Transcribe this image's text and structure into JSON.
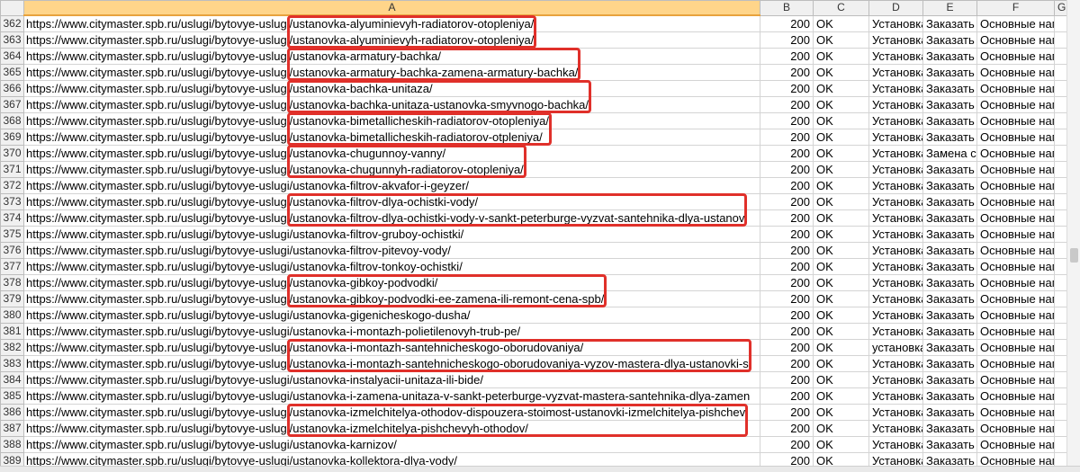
{
  "columns": [
    "A",
    "B",
    "C",
    "D",
    "E",
    "F",
    "G"
  ],
  "selected_column": "A",
  "url_prefix": "https://www.citymaster.spb.ru/uslugi/bytovye-uslugi",
  "rows": [
    {
      "n": "362",
      "slug": "/ustanovka-alyuminievyh-radiatorov-otopleniya/",
      "code": "200",
      "status": "OK",
      "d": "Установка",
      "e": "Заказать у",
      "f": "Основные напра"
    },
    {
      "n": "363",
      "slug": "/ustanovka-alyuminievyh-radiatorov-otopleniya/",
      "code": "200",
      "status": "OK",
      "d": "Установка",
      "e": "Заказать у",
      "f": "Основные напра"
    },
    {
      "n": "364",
      "slug": "/ustanovka-armatury-bachka/",
      "code": "200",
      "status": "OK",
      "d": "Установка",
      "e": "Заказать у",
      "f": "Основные напра"
    },
    {
      "n": "365",
      "slug": "/ustanovka-armatury-bachka-zamena-armatury-bachka/",
      "code": "200",
      "status": "OK",
      "d": "Установка",
      "e": "Заказать у",
      "f": "Основные напра"
    },
    {
      "n": "366",
      "slug": "/ustanovka-bachka-unitaza/",
      "code": "200",
      "status": "OK",
      "d": "Установка",
      "e": "Заказать у",
      "f": "Основные напра"
    },
    {
      "n": "367",
      "slug": "/ustanovka-bachka-unitaza-ustanovka-smyvnogo-bachka/",
      "code": "200",
      "status": "OK",
      "d": "Установка",
      "e": "Заказать у",
      "f": "Основные напра"
    },
    {
      "n": "368",
      "slug": "/ustanovka-bimetallicheskih-radiatorov-otopleniya/",
      "code": "200",
      "status": "OK",
      "d": "Установка",
      "e": "Заказать у",
      "f": "Основные напра"
    },
    {
      "n": "369",
      "slug": "/ustanovka-bimetallicheskih-radiatorov-otpleniya/",
      "code": "200",
      "status": "OK",
      "d": "Установка",
      "e": "Заказать у",
      "f": "Основные напра"
    },
    {
      "n": "370",
      "slug": "/ustanovka-chugunnoy-vanny/",
      "code": "200",
      "status": "OK",
      "d": "Установка",
      "e": "Замена ст",
      "f": "Основные напра"
    },
    {
      "n": "371",
      "slug": "/ustanovka-chugunnyh-radiatorov-otopleniya/",
      "code": "200",
      "status": "OK",
      "d": "Установка",
      "e": "Заказать у",
      "f": "Основные напра"
    },
    {
      "n": "372",
      "slug": "/ustanovka-filtrov-akvafor-i-geyzer/",
      "code": "200",
      "status": "OK",
      "d": "Установка",
      "e": "Заказать у",
      "f": "Основные напра"
    },
    {
      "n": "373",
      "slug": "/ustanovka-filtrov-dlya-ochistki-vody/",
      "code": "200",
      "status": "OK",
      "d": "Установка",
      "e": "Заказать у",
      "f": "Основные напра"
    },
    {
      "n": "374",
      "slug": "/ustanovka-filtrov-dlya-ochistki-vody-v-sankt-peterburge-vyzvat-santehnika-dlya-ustanov",
      "code": "200",
      "status": "OK",
      "d": "Установка",
      "e": "Заказать у",
      "f": "Основные напра"
    },
    {
      "n": "375",
      "slug": "/ustanovka-filtrov-gruboy-ochistki/",
      "code": "200",
      "status": "OK",
      "d": "Установка",
      "e": "Заказать у",
      "f": "Основные напра"
    },
    {
      "n": "376",
      "slug": "/ustanovka-filtrov-pitevoy-vody/",
      "code": "200",
      "status": "OK",
      "d": "Установка",
      "e": "Заказать у",
      "f": "Основные напра"
    },
    {
      "n": "377",
      "slug": "/ustanovka-filtrov-tonkoy-ochistki/",
      "code": "200",
      "status": "OK",
      "d": "Установка",
      "e": "Заказать у",
      "f": "Основные напра"
    },
    {
      "n": "378",
      "slug": "/ustanovka-gibkoy-podvodki/",
      "code": "200",
      "status": "OK",
      "d": "Установка",
      "e": "Заказать у",
      "f": "Основные напра"
    },
    {
      "n": "379",
      "slug": "/ustanovka-gibkoy-podvodki-ee-zamena-ili-remont-cena-spb/",
      "code": "200",
      "status": "OK",
      "d": "Установка",
      "e": "Заказать у",
      "f": "Основные напра"
    },
    {
      "n": "380",
      "slug": "/ustanovka-gigenicheskogo-dusha/",
      "code": "200",
      "status": "OK",
      "d": "Установка",
      "e": "Заказать у",
      "f": "Основные напра"
    },
    {
      "n": "381",
      "slug": "/ustanovka-i-montazh-polietilenovyh-trub-pe/",
      "code": "200",
      "status": "OK",
      "d": "Установка",
      "e": "Заказать у",
      "f": "Основные напра"
    },
    {
      "n": "382",
      "slug": "/ustanovka-i-montazh-santehnicheskogo-oborudovaniya/",
      "code": "200",
      "status": "OK",
      "d": "установка",
      "e": "Заказать у",
      "f": "Основные напра"
    },
    {
      "n": "383",
      "slug": "/ustanovka-i-montazh-santehnicheskogo-oborudovaniya-vyzov-mastera-dlya-ustanovki-s",
      "code": "200",
      "status": "OK",
      "d": "Установка",
      "e": "Заказать у",
      "f": "Основные напра"
    },
    {
      "n": "384",
      "slug": "/ustanovka-instalyacii-unitaza-ili-bide/",
      "code": "200",
      "status": "OK",
      "d": "Установка",
      "e": "Заказать у",
      "f": "Основные напра"
    },
    {
      "n": "385",
      "slug": "/ustanovka-i-zamena-unitaza-v-sankt-peterburge-vyzvat-mastera-santehnika-dlya-zamen",
      "code": "200",
      "status": "OK",
      "d": "Установка",
      "e": "Заказать у",
      "f": "Основные напра"
    },
    {
      "n": "386",
      "slug": "/ustanovka-izmelchitelya-othodov-dispouzera-stoimost-ustanovki-izmelchitelya-pishchev",
      "code": "200",
      "status": "OK",
      "d": "Установка",
      "e": "Заказать у",
      "f": "Основные напра"
    },
    {
      "n": "387",
      "slug": "/ustanovka-izmelchitelya-pishchevyh-othodov/",
      "code": "200",
      "status": "OK",
      "d": "Установка",
      "e": "Заказать у",
      "f": "Основные напра"
    },
    {
      "n": "388",
      "slug": "/ustanovka-karnizov/",
      "code": "200",
      "status": "OK",
      "d": "Установка",
      "e": "Заказать у",
      "f": "Основные напра"
    },
    {
      "n": "389",
      "slug": "/ustanovka-kollektora-dlya-vody/",
      "code": "200",
      "status": "OK",
      "d": "Установка",
      "e": "Заказать у",
      "f": "Основные напра"
    }
  ],
  "highlight_color": "#e0302a"
}
